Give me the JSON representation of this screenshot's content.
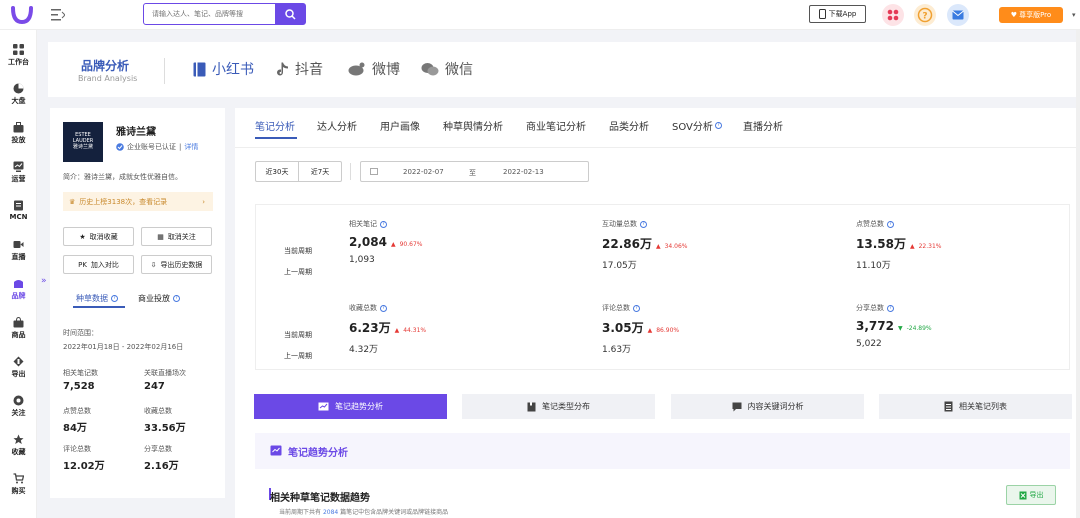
{
  "topbar": {
    "search_placeholder": "请输入达人、笔记、品牌等搜",
    "download_label": "下载App",
    "vip_label": "尊享版Pro"
  },
  "sidebar": {
    "items": [
      {
        "label": "工作台",
        "icon": "grid-icon"
      },
      {
        "label": "大盘",
        "icon": "pie-icon"
      },
      {
        "label": "投放",
        "icon": "briefcase-icon"
      },
      {
        "label": "运营",
        "icon": "chart-icon"
      },
      {
        "label": "MCN",
        "icon": "doc-icon"
      },
      {
        "label": "直播",
        "icon": "video-icon"
      },
      {
        "label": "品牌",
        "icon": "brand-icon"
      },
      {
        "label": "商品",
        "icon": "bag-icon"
      },
      {
        "label": "导出",
        "icon": "export-icon"
      },
      {
        "label": "关注",
        "icon": "eye-icon"
      },
      {
        "label": "收藏",
        "icon": "star-icon"
      },
      {
        "label": "购买",
        "icon": "cart-icon"
      }
    ],
    "collapse_glyph": "»"
  },
  "header": {
    "title": "品牌分析",
    "subtitle": "Brand Analysis",
    "platforms": [
      {
        "label": "小红书"
      },
      {
        "label": "抖音"
      },
      {
        "label": "微博"
      },
      {
        "label": "微信"
      }
    ]
  },
  "brand": {
    "logo_line1": "ESTEE",
    "logo_line2": "LAUDER",
    "logo_line3": "雅诗兰黛",
    "name": "雅诗兰黛",
    "verified": "企业账号已认证",
    "verified_link": "详情",
    "intro": "简介：雅诗兰黛，成就女性优雅自信。",
    "history": "历史上榜3138次，查看记录",
    "history_arrow": "›",
    "buttons": {
      "unfav": "取消收藏",
      "unfollow": "取消关注",
      "compare": "加入对比",
      "compare_prefix": "PK",
      "export": "导出历史数据"
    },
    "tabs": [
      "种草数据",
      "商业投放"
    ],
    "range_label": "时间范围：",
    "range_value": "2022年01月18日 - 2022年02月16日",
    "stats": [
      {
        "label": "相关笔记数",
        "value": "7,528"
      },
      {
        "label": "关联直播场次",
        "value": "247"
      },
      {
        "label": "点赞总数",
        "value": "84万"
      },
      {
        "label": "收藏总数",
        "value": "33.56万"
      },
      {
        "label": "评论总数",
        "value": "12.02万"
      },
      {
        "label": "分享总数",
        "value": "2.16万"
      }
    ]
  },
  "main": {
    "tabs": [
      "笔记分析",
      "达人分析",
      "用户画像",
      "种草舆情分析",
      "商业笔记分析",
      "品类分析",
      "SOV分析",
      "直播分析"
    ],
    "period": [
      "近30天",
      "近7天"
    ],
    "date_start": "2022-02-07",
    "date_sep": "至",
    "date_end": "2022-02-13",
    "row_current": "当前周期",
    "row_previous": "上一周期",
    "metrics": [
      {
        "label": "相关笔记",
        "current": "2,084",
        "change": "90.67%",
        "dir": "up",
        "previous": "1,093"
      },
      {
        "label": "互动量总数",
        "current": "22.86万",
        "change": "34.06%",
        "dir": "up",
        "previous": "17.05万"
      },
      {
        "label": "点赞总数",
        "current": "13.58万",
        "change": "22.31%",
        "dir": "up",
        "previous": "11.10万"
      },
      {
        "label": "收藏总数",
        "current": "6.23万",
        "change": "44.31%",
        "dir": "up",
        "previous": "4.32万"
      },
      {
        "label": "评论总数",
        "current": "3.05万",
        "change": "86.90%",
        "dir": "up",
        "previous": "1.63万"
      },
      {
        "label": "分享总数",
        "current": "3,772",
        "change": "-24.89%",
        "dir": "down",
        "previous": "5,022"
      }
    ],
    "bottom_tabs": [
      "笔记趋势分析",
      "笔记类型分布",
      "内容关键词分析",
      "相关笔记列表"
    ],
    "trend_title": "笔记趋势分析",
    "trend_subtitle": "相关种草笔记数据趋势",
    "trend_desc_pre": "当前周期下共有",
    "trend_desc_num": "2084",
    "trend_desc_post": "篇笔记中包含品牌关键词或品牌链接商品",
    "export_label": "导出"
  },
  "colors": {
    "accent": "#6b49e6",
    "link": "#3a5bb8",
    "up": "#e53935",
    "down": "#22a845",
    "vip": "#ff8c1a"
  }
}
